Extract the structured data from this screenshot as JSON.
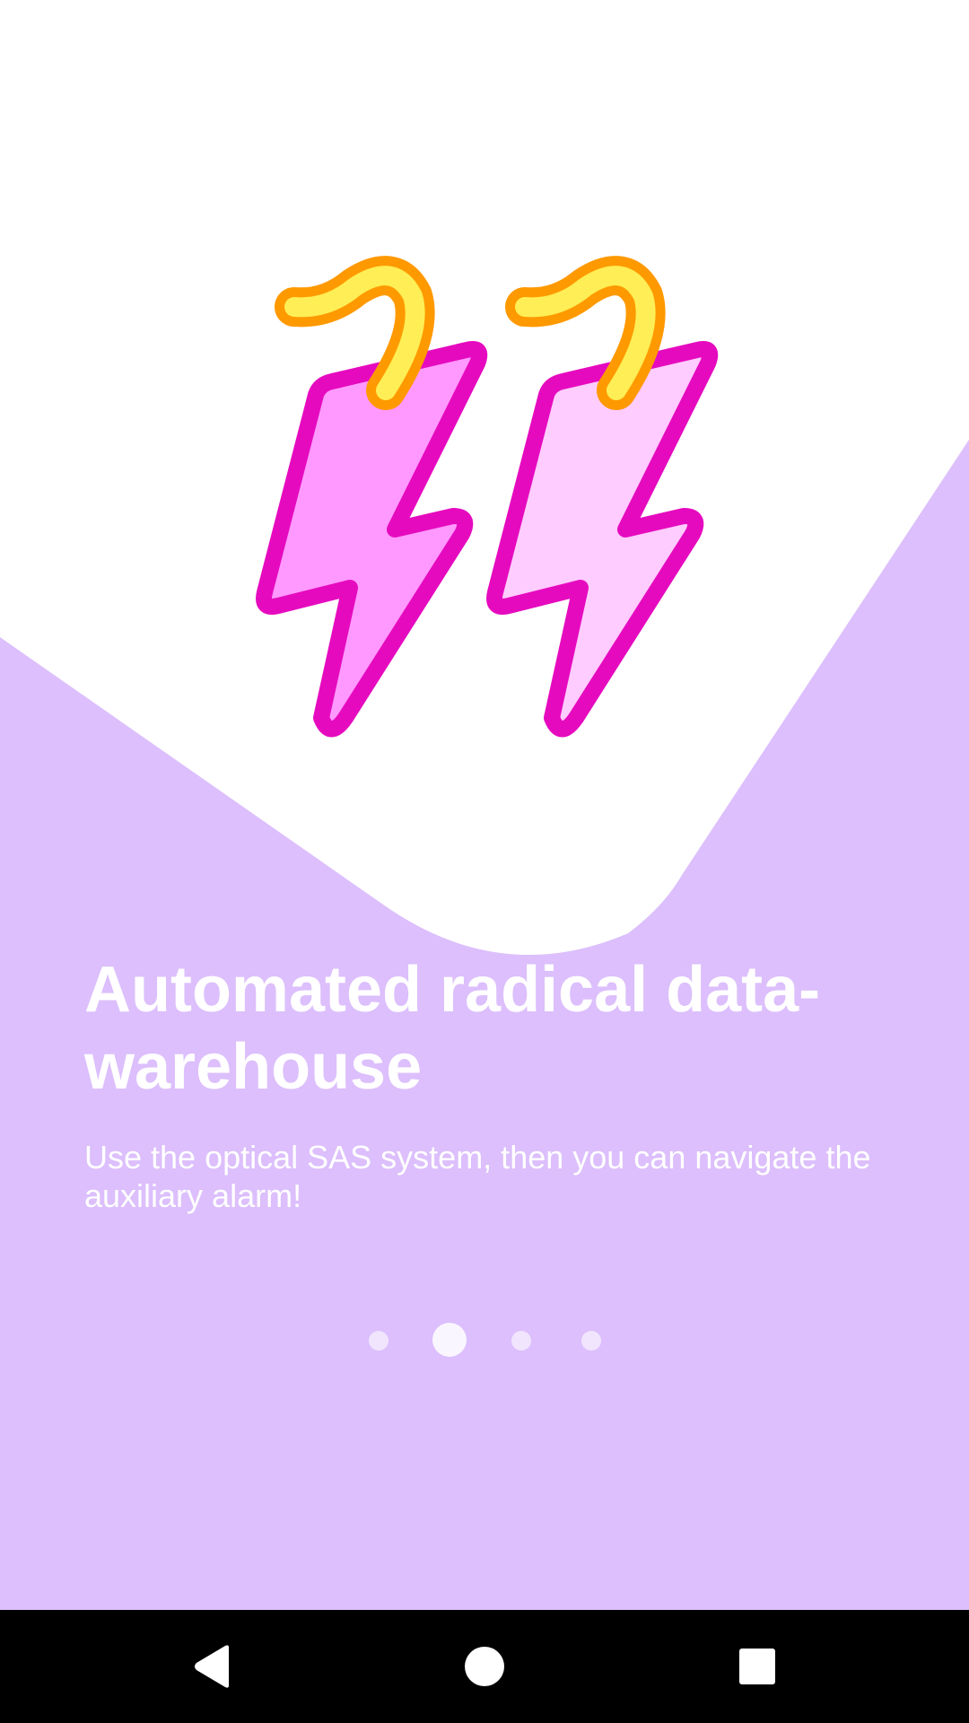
{
  "theme": {
    "background": "#ffffff",
    "accent": "#dcbffc",
    "navbar": "#000000"
  },
  "illustration": {
    "icon": "double-lightning-bolt-icon"
  },
  "onboarding": {
    "title": "Automated radical data-warehouse",
    "subtitle": "Use the optical SAS system, then you can navigate the auxiliary alarm!",
    "page_count": 4,
    "current_page": 2
  },
  "navbar": {
    "back_icon": "back-triangle-icon",
    "home_icon": "home-circle-icon",
    "recents_icon": "recents-square-icon"
  }
}
